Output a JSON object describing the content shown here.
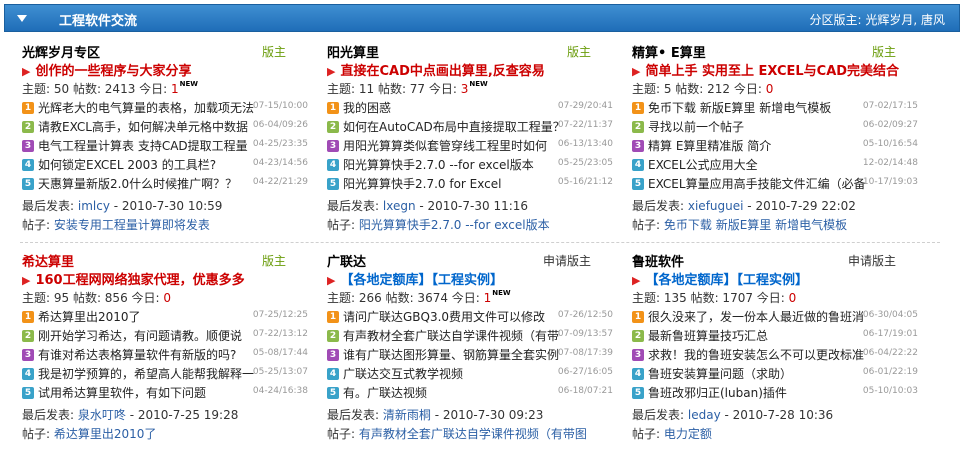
{
  "header": {
    "title": "工程软件交流",
    "moderators_label": "分区版主:",
    "moderators": "光辉岁月, 唐风"
  },
  "cards": [
    {
      "name": "光辉岁月专区",
      "mod_label": "版主",
      "promo": "创作的一些程序与大家分享",
      "promo_color": "#cc0000",
      "stats_prefix": "主题: 50  帖数: 2413  今日: ",
      "today": "1",
      "today_new": "NEW",
      "threads": [
        {
          "icon": "1",
          "color": "orange",
          "title": "光辉老大的电气算量的表格，加载项无法",
          "date": "07-15/10:00"
        },
        {
          "icon": "2",
          "color": "green",
          "title": "请教EXCL高手，如何解决单元格中数据",
          "date": "06-04/09:26"
        },
        {
          "icon": "3",
          "color": "purple",
          "title": "电气工程量计算表  支持CAD提取工程量",
          "date": "04-25/23:35"
        },
        {
          "icon": "4",
          "color": "cyan",
          "title": "如何锁定EXCEL 2003 的工具栏?",
          "date": "04-23/14:56"
        },
        {
          "icon": "5",
          "color": "cyan",
          "title": "天惠算量新版2.0什么时候推广啊？？",
          "date": "04-22/21:29"
        }
      ],
      "last_label": "最后发表:",
      "last_user": "imlcy",
      "last_time": "- 2010-7-30 10:59",
      "post_label": "帖子:",
      "post_title": "安装专用工程量计算即将发表"
    },
    {
      "name": "阳光算里",
      "mod_label": "版主",
      "promo": "直接在CAD中点画出算里,反查容易",
      "promo_color": "#cc0000",
      "stats_prefix": "主题: 11  帖数: 77  今日: ",
      "today": "3",
      "today_new": "NEW",
      "threads": [
        {
          "icon": "1",
          "color": "orange",
          "title": "我的困惑",
          "date": "07-29/20:41"
        },
        {
          "icon": "2",
          "color": "green",
          "title": "如何在AutoCAD布局中直接提取工程量？",
          "date": "07-22/11:37"
        },
        {
          "icon": "3",
          "color": "purple",
          "title": "用阳光算算类似套管穿线工程里时如何",
          "date": "06-13/13:40"
        },
        {
          "icon": "4",
          "color": "cyan",
          "title": "阳光算算快手2.7.0 --for excel版本",
          "date": "05-25/23:05"
        },
        {
          "icon": "5",
          "color": "cyan",
          "title": "阳光算算快手2.7.0 for Excel",
          "date": "05-16/21:12"
        }
      ],
      "last_label": "最后发表:",
      "last_user": "lxegn",
      "last_time": "- 2010-7-30 11:16",
      "post_label": "帖子:",
      "post_title": "阳光算算快手2.7.0 --for excel版本"
    },
    {
      "name": "精算• E算里",
      "mod_label": "版主",
      "promo": "简单上手  实用至上  EXCEL与CAD完美结合",
      "promo_color": "#cc0000",
      "stats_prefix": "主题: 5  帖数: 212  今日: ",
      "today": "0",
      "today_new": "",
      "threads": [
        {
          "icon": "1",
          "color": "orange",
          "title": "免币下载 新版E算里 新增电气模板",
          "date": "07-02/17:15"
        },
        {
          "icon": "2",
          "color": "green",
          "title": "寻找以前一个帖子",
          "date": "06-02/09:27"
        },
        {
          "icon": "3",
          "color": "purple",
          "title": "精算  E算里精准版  简介",
          "date": "05-10/16:54"
        },
        {
          "icon": "4",
          "color": "cyan",
          "title": "EXCEL公式应用大全",
          "date": "12-02/14:48"
        },
        {
          "icon": "5",
          "color": "cyan",
          "title": "EXCEL算量应用高手技能文件汇编（必备",
          "date": "10-17/19:03"
        }
      ],
      "last_label": "最后发表:",
      "last_user": "xiefuguei",
      "last_time": "- 2010-7-29 22:02",
      "post_label": "帖子:",
      "post_title": "免币下载 新版E算里 新增电气模板"
    },
    {
      "name": "希达算里",
      "mod_label": "版主",
      "promo": "160工程网网络独家代理，优惠多多",
      "promo_color": "#cc0000",
      "stats_prefix": "主题: 95  帖数: 856  今日: ",
      "today": "0",
      "today_new": "",
      "threads": [
        {
          "icon": "1",
          "color": "orange",
          "title": "希达算里出2010了",
          "date": "07-25/12:25"
        },
        {
          "icon": "2",
          "color": "green",
          "title": "刚开始学习希达，有问题请教。顺便说",
          "date": "07-22/13:12"
        },
        {
          "icon": "3",
          "color": "purple",
          "title": "有谁对希达表格算量软件有新版的吗?",
          "date": "05-08/17:44"
        },
        {
          "icon": "4",
          "color": "cyan",
          "title": "我是初学预算的，希望高人能帮我解释一",
          "date": "05-25/13:07"
        },
        {
          "icon": "5",
          "color": "cyan",
          "title": "试用希达算里软件，有如下问题",
          "date": "04-24/16:38"
        }
      ],
      "last_label": "最后发表:",
      "last_user": "泉水叮咚",
      "last_time": "- 2010-7-25 19:28",
      "post_label": "帖子:",
      "post_title": "希达算里出2010了"
    },
    {
      "name": "广联达",
      "mod_label": "申请版主",
      "promo": "【各地定额库】【工程实例】",
      "promo_color": "#0066cc",
      "stats_prefix": "主题: 266  帖数: 3674  今日: ",
      "today": "1",
      "today_new": "NEW",
      "threads": [
        {
          "icon": "1",
          "color": "orange",
          "title": "请问广联达GBQ3.0费用文件可以修改",
          "date": "07-26/12:50"
        },
        {
          "icon": "2",
          "color": "green",
          "title": "有声教材全套广联达自学课件视频（有带",
          "date": "07-09/13:57"
        },
        {
          "icon": "3",
          "color": "purple",
          "title": "谁有广联达图形算量、钢筋算量全套实例",
          "date": "07-08/17:39"
        },
        {
          "icon": "4",
          "color": "cyan",
          "title": "广联达交互式教学视频",
          "date": "06-27/16:05"
        },
        {
          "icon": "5",
          "color": "cyan",
          "title": "有。广联达视频",
          "date": "06-18/07:21"
        }
      ],
      "last_label": "最后发表:",
      "last_user": "清新雨桐",
      "last_time": "- 2010-7-30 09:23",
      "post_label": "帖子:",
      "post_title": "有声教材全套广联达自学课件视频（有带图"
    },
    {
      "name": "鲁班软件",
      "mod_label": "申请版主",
      "promo": "【各地定额库】【工程实例】",
      "promo_color": "#0066cc",
      "stats_prefix": "主题: 135  帖数: 1707  今日: ",
      "today": "0",
      "today_new": "",
      "threads": [
        {
          "icon": "1",
          "color": "orange",
          "title": "很久没来了，发一份本人最近做的鲁班消",
          "date": "06-30/04:05"
        },
        {
          "icon": "2",
          "color": "green",
          "title": "最新鲁班算量技巧汇总",
          "date": "06-17/19:01"
        },
        {
          "icon": "3",
          "color": "purple",
          "title": "求救！我的鲁班安装怎么不可以更改标准",
          "date": "06-04/22:22"
        },
        {
          "icon": "4",
          "color": "cyan",
          "title": "鲁班安装算量问题（求助）",
          "date": "06-01/22:19"
        },
        {
          "icon": "5",
          "color": "cyan",
          "title": "鲁班改邪归正(luban)插件",
          "date": "05-10/10:03"
        }
      ],
      "last_label": "最后发表:",
      "last_user": "leday",
      "last_time": "- 2010-7-28 10:36",
      "post_label": "帖子:",
      "post_title": "电力定额"
    }
  ]
}
